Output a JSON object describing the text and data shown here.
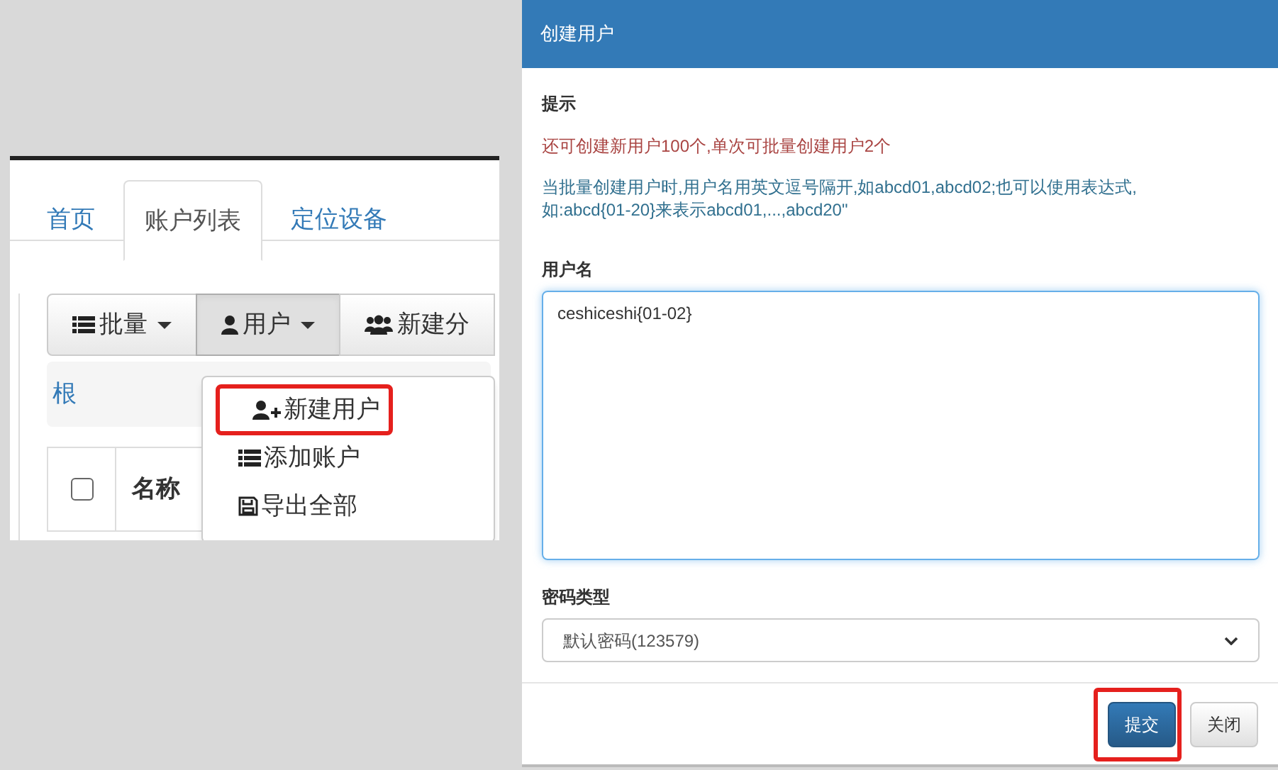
{
  "left_panel": {
    "tabs": [
      {
        "label": "首页",
        "selected": false
      },
      {
        "label": "账户列表",
        "selected": true
      },
      {
        "label": "定位设备",
        "selected": false
      }
    ],
    "toolbar": [
      {
        "label": "批量",
        "kind": "list",
        "caret": true,
        "selected": false
      },
      {
        "label": "用户",
        "kind": "user",
        "caret": true,
        "selected": true
      },
      {
        "label": "新建分",
        "kind": "users",
        "caret": false,
        "selected": false
      }
    ],
    "breadcrumb": "根",
    "dropdown": [
      {
        "label": "新建用户",
        "kind": "user-plus",
        "highlighted": true
      },
      {
        "label": "添加账户",
        "kind": "list",
        "highlighted": false
      },
      {
        "label": "导出全部",
        "kind": "save",
        "highlighted": false
      }
    ],
    "table": {
      "select_all_checked": false,
      "columns": [
        "名称"
      ]
    }
  },
  "dialog": {
    "title": "创建用户",
    "hint_label": "提示",
    "quota_text": "还可创建新用户100个,单次可批量创建用户2个",
    "help_text": "当批量创建用户时,用户名用英文逗号隔开,如abcd01,abcd02;也可以使用表达式,\n如:abcd{01-20}来表示abcd01,...,abcd20\"",
    "username_label": "用户名",
    "username_value": "ceshiceshi{01-02}",
    "password_type_label": "密码类型",
    "password_type_value": "默认密码(123579)",
    "buttons": [
      {
        "label": "提交",
        "kind": "primary",
        "highlighted": true
      },
      {
        "label": "关闭",
        "kind": "default",
        "highlighted": false
      }
    ]
  }
}
